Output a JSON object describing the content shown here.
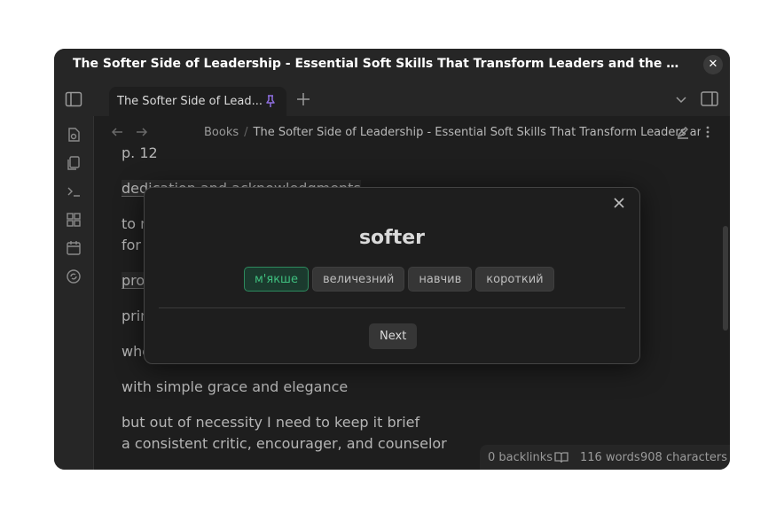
{
  "window": {
    "title": "The Softer Side of Leadership - Essential Soft Skills That Transform Leaders and the People They Lea...",
    "close": "✕"
  },
  "tab": {
    "label": "The Softer Side of Lead..."
  },
  "breadcrumb": {
    "folder": "Books",
    "separator": "/",
    "current": "The Softer Side of Leadership - Essential Soft Skills That Transform Leaders and the"
  },
  "content": {
    "lines": [
      "p. 12",
      "dedication and acknowledgments",
      "to m",
      "for",
      "pro",
      "prin",
      "who",
      "with simple grace and elegance",
      "but out of necessity I need to keep it brief",
      "a consistent critic, encourager, and counselor"
    ]
  },
  "status": {
    "backlinks": "0 backlinks",
    "words": "116 words",
    "characters": "908 characters"
  },
  "quiz": {
    "word": "softer",
    "options": [
      "м'якше",
      "величезний",
      "навчив",
      "короткий"
    ],
    "next_label": "Next"
  },
  "colors": {
    "accent": "#3fbf7f",
    "pin": "#8f6fe0"
  }
}
